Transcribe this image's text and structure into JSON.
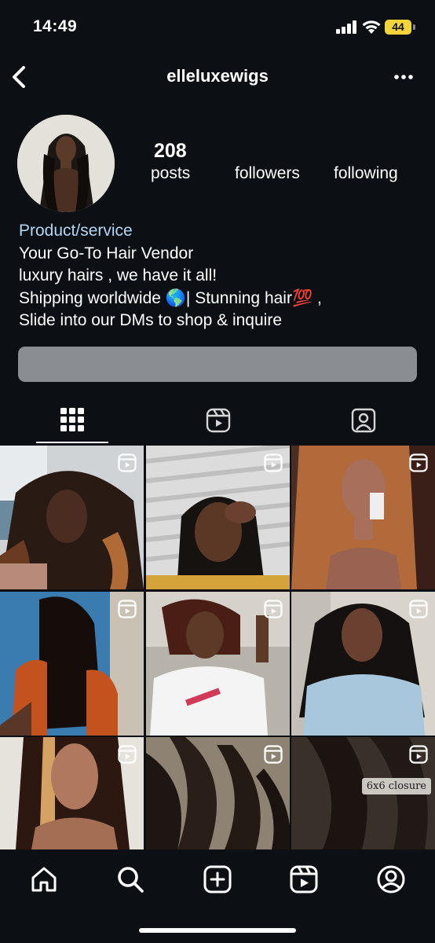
{
  "status_bar": {
    "time": "14:49",
    "battery": "44"
  },
  "header": {
    "username": "elleluxewigs",
    "back_icon": "chevron-left-icon",
    "more_icon": "more-horizontal-icon"
  },
  "profile": {
    "stats": {
      "posts_count": "208",
      "posts_label": "posts",
      "followers_label": "followers",
      "following_label": "following"
    },
    "bio": {
      "category": "Product/service",
      "lines": [
        "Your Go-To Hair Vendor",
        "luxury hairs , we have it all!",
        "Shipping worldwide 🌎| Stunning hair💯 ,",
        "Slide into our DMs to shop & inquire"
      ]
    }
  },
  "tabs": [
    {
      "name": "grid",
      "icon": "grid-icon",
      "selected": true
    },
    {
      "name": "reels",
      "icon": "reels-icon",
      "selected": false
    },
    {
      "name": "tagged",
      "icon": "tagged-user-icon",
      "selected": false
    }
  ],
  "posts": [
    {
      "type": "reel",
      "caption_overlay": ""
    },
    {
      "type": "reel",
      "caption_overlay": ""
    },
    {
      "type": "reel",
      "caption_overlay": ""
    },
    {
      "type": "reel",
      "caption_overlay": ""
    },
    {
      "type": "reel",
      "caption_overlay": ""
    },
    {
      "type": "reel",
      "caption_overlay": ""
    },
    {
      "type": "reel",
      "caption_overlay": ""
    },
    {
      "type": "reel",
      "caption_overlay": ""
    },
    {
      "type": "reel",
      "caption_overlay": "6x6 closure"
    }
  ],
  "bottom_nav": [
    {
      "name": "home",
      "icon": "home-icon"
    },
    {
      "name": "search",
      "icon": "search-icon"
    },
    {
      "name": "create",
      "icon": "plus-square-icon"
    },
    {
      "name": "reels",
      "icon": "reels-icon"
    },
    {
      "name": "profile",
      "icon": "profile-icon"
    }
  ],
  "colors": {
    "background": "#0c0f13",
    "category_link": "#b4d6f5",
    "battery": "#f3d43b",
    "action_bar": "#8a8d91"
  }
}
